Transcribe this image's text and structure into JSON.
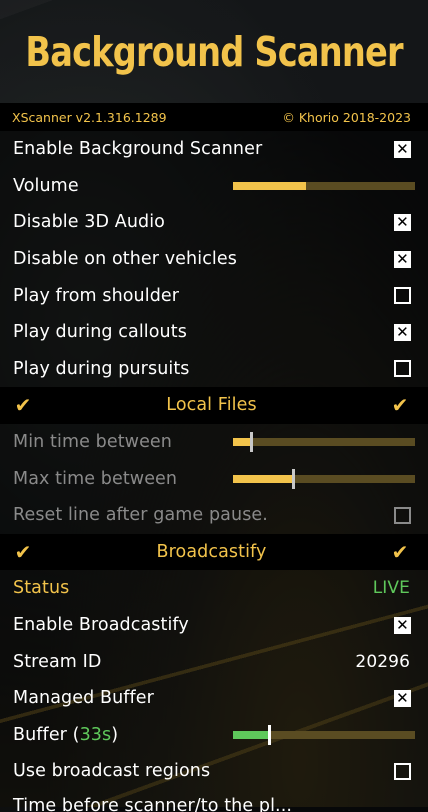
{
  "banner": {
    "title": "Background Scanner"
  },
  "subheader": {
    "version": "XScanner v2.1.316.1289",
    "copyright": "© Khorio 2018-2023"
  },
  "items": [
    {
      "label": "Enable Background Scanner",
      "checked": true
    },
    {
      "label": "Volume",
      "slider": 0.4
    },
    {
      "label": "Disable 3D Audio",
      "checked": true
    },
    {
      "label": "Disable on other vehicles",
      "checked": true
    },
    {
      "label": "Play from shoulder",
      "checked": false
    },
    {
      "label": "Play during callouts",
      "checked": true
    },
    {
      "label": "Play during pursuits",
      "checked": false
    }
  ],
  "sections": {
    "local_files": "Local Files",
    "broadcastify": "Broadcastify"
  },
  "local": [
    {
      "label": "Min time between",
      "slider": 0.1
    },
    {
      "label": "Max time between",
      "slider": 0.33
    },
    {
      "label": "Reset line after game pause.",
      "checked": false
    }
  ],
  "broadcast": {
    "status_label": "Status",
    "status_value": "LIVE",
    "enable_label": "Enable Broadcastify",
    "enable_checked": true,
    "stream_label": "Stream ID",
    "stream_value": "20296",
    "managed_label": "Managed Buffer",
    "managed_checked": true,
    "buffer_label": "Buffer (",
    "buffer_value": "33s",
    "buffer_close": ")",
    "buffer_level": 0.2,
    "regions_label": "Use broadcast regions",
    "regions_checked": false,
    "cut_label": "Time before scanner/to the pl..."
  },
  "icons": {
    "checkbox_checked": "checkbox-checked-icon",
    "checkbox_empty": "checkbox-empty-icon",
    "tick": "checkmark-icon"
  },
  "colors": {
    "accent": "#f2c34b",
    "live": "#5fc85b"
  }
}
